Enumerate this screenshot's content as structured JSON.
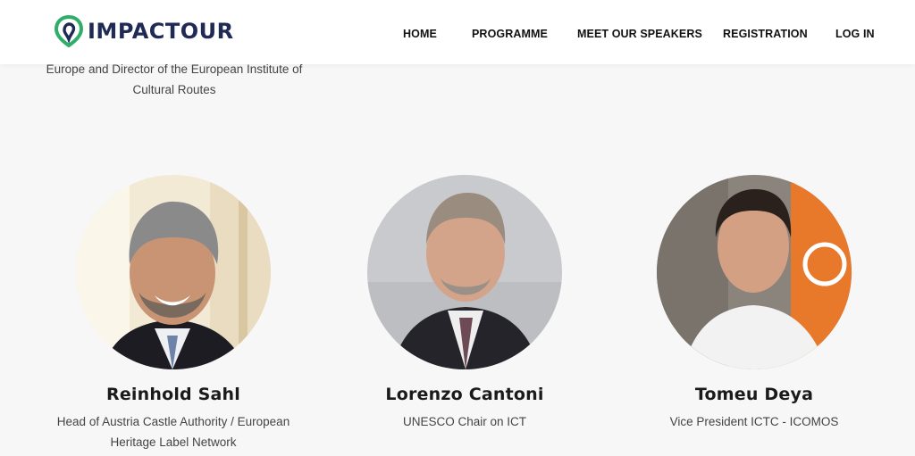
{
  "brand": {
    "name": "IMPACTOUR",
    "accent": "#2fae6a",
    "dark": "#1f2a55"
  },
  "nav": {
    "items": [
      {
        "label": "HOME"
      },
      {
        "label": "PROGRAMME"
      },
      {
        "label": "MEET OUR SPEAKERS"
      },
      {
        "label": "REGISTRATION"
      },
      {
        "label": "LOG IN"
      }
    ]
  },
  "previous_speaker": {
    "role": "Europe and Director of the European Institute of Cultural Routes"
  },
  "speakers": [
    {
      "name": "Reinhold Sahl",
      "role": "Head of Austria Castle Authority / European Heritage Label Network"
    },
    {
      "name": "Lorenzo Cantoni",
      "role": "UNESCO Chair on ICT"
    },
    {
      "name": "Tomeu Deya",
      "role": "Vice President ICTC - ICOMOS"
    }
  ]
}
